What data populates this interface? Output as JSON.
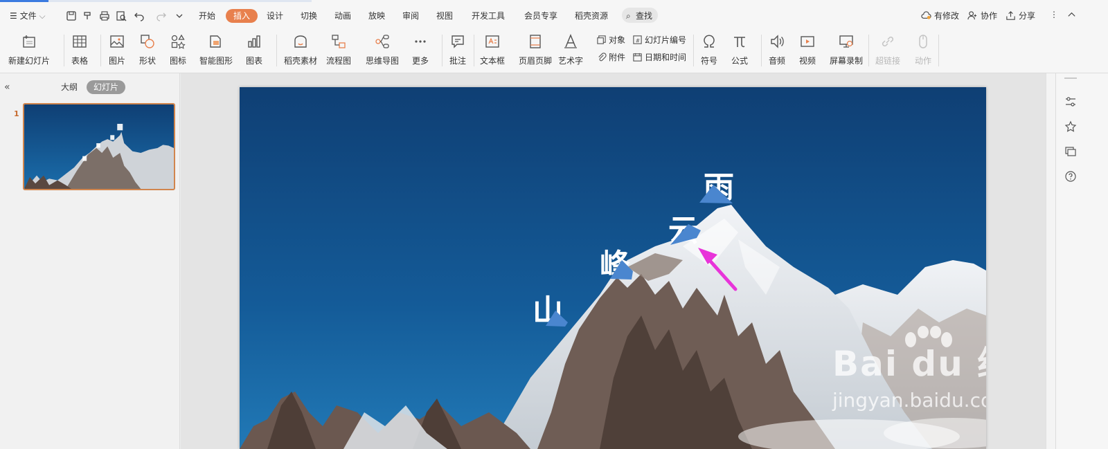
{
  "menu": {
    "file_label": "文件",
    "tabs": [
      {
        "label": "开始",
        "active": false
      },
      {
        "label": "插入",
        "active": true
      },
      {
        "label": "设计",
        "active": false
      },
      {
        "label": "切换",
        "active": false
      },
      {
        "label": "动画",
        "active": false
      },
      {
        "label": "放映",
        "active": false
      },
      {
        "label": "审阅",
        "active": false
      },
      {
        "label": "视图",
        "active": false
      },
      {
        "label": "开发工具",
        "active": false
      },
      {
        "label": "会员专享",
        "active": false
      },
      {
        "label": "稻壳资源",
        "active": false
      }
    ],
    "search_label": "查找",
    "modified_label": "有修改",
    "collab_label": "协作",
    "share_label": "分享"
  },
  "ribbon": {
    "new_slide": "新建幻灯片",
    "table": "表格",
    "picture": "图片",
    "shape": "形状",
    "icon": "图标",
    "smartart": "智能图形",
    "chart": "图表",
    "docer_material": "稻壳素材",
    "flowchart": "流程图",
    "mindmap": "思维导图",
    "more": "更多",
    "comment": "批注",
    "textbox": "文本框",
    "header_footer": "页眉页脚",
    "wordart": "艺术字",
    "object": "对象",
    "slide_number": "幻灯片编号",
    "attachment": "附件",
    "datetime": "日期和时间",
    "symbol": "符号",
    "formula": "公式",
    "audio": "音频",
    "video": "视频",
    "screen_record": "屏幕录制",
    "hyperlink": "超链接",
    "action": "动作"
  },
  "panel": {
    "outline_tab": "大纲",
    "slides_tab": "幻灯片",
    "slide_number": "1"
  },
  "slide": {
    "chars": [
      "山",
      "峰",
      "云",
      "雨"
    ],
    "watermark_brand": "Bai du 经验",
    "watermark_url": "jingyan.baidu.com"
  },
  "colors": {
    "accent": "#e8804d",
    "sky_top": "#0f3f74",
    "sky_bottom": "#1a6dab",
    "marker": "#4a86cf",
    "arrow": "#e834d9"
  }
}
